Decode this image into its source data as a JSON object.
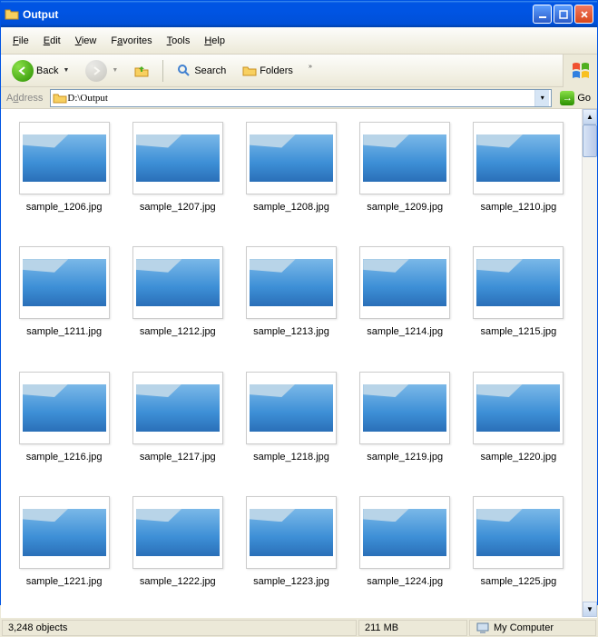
{
  "window": {
    "title": "Output"
  },
  "menu": {
    "file": "File",
    "edit": "Edit",
    "view": "View",
    "favorites": "Favorites",
    "tools": "Tools",
    "help": "Help"
  },
  "toolbar": {
    "back": "Back",
    "search": "Search",
    "folders": "Folders"
  },
  "address": {
    "label": "Address",
    "value": "D:\\Output",
    "go": "Go"
  },
  "files": [
    {
      "name": "sample_1206.jpg"
    },
    {
      "name": "sample_1207.jpg"
    },
    {
      "name": "sample_1208.jpg"
    },
    {
      "name": "sample_1209.jpg"
    },
    {
      "name": "sample_1210.jpg"
    },
    {
      "name": "sample_1211.jpg"
    },
    {
      "name": "sample_1212.jpg"
    },
    {
      "name": "sample_1213.jpg"
    },
    {
      "name": "sample_1214.jpg"
    },
    {
      "name": "sample_1215.jpg"
    },
    {
      "name": "sample_1216.jpg"
    },
    {
      "name": "sample_1217.jpg"
    },
    {
      "name": "sample_1218.jpg"
    },
    {
      "name": "sample_1219.jpg"
    },
    {
      "name": "sample_1220.jpg"
    },
    {
      "name": "sample_1221.jpg"
    },
    {
      "name": "sample_1222.jpg"
    },
    {
      "name": "sample_1223.jpg"
    },
    {
      "name": "sample_1224.jpg"
    },
    {
      "name": "sample_1225.jpg"
    }
  ],
  "status": {
    "objects": "3,248 objects",
    "size": "211 MB",
    "location": "My Computer"
  }
}
